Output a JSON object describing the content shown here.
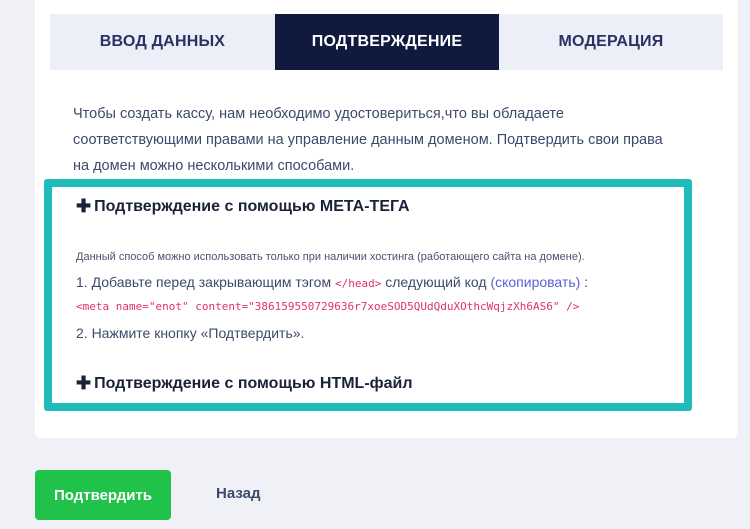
{
  "tabs": [
    {
      "label": "ВВОД ДАННЫХ",
      "active": false
    },
    {
      "label": "ПОДТВЕРЖДЕНИЕ",
      "active": true
    },
    {
      "label": "МОДЕРАЦИЯ",
      "active": false
    }
  ],
  "intro": {
    "line1": "Чтобы создать кассу, нам необходимо удостовериться,что вы обладаете",
    "line2": "соответствующими правами на управление данным доменом. Подтвердить свои права",
    "line3": "на домен можно несколькими способами."
  },
  "methods": [
    {
      "icon": "plus-icon",
      "title": "Подтверждение с помощью МЕТА-ТЕГА"
    },
    {
      "icon": "plus-icon",
      "title": "Подтверждение с помощью HTML-файл"
    }
  ],
  "meta_method": {
    "note": "Данный способ можно использовать только при наличии хостинга (работающего сайта на домене).",
    "step1_prefix": "1. Добавьте перед закрывающим тэгом ",
    "step1_tag": "</head>",
    "step1_middle": " следующий код ",
    "step1_copy": "(скопировать)",
    "step1_suffix": " :",
    "code": "<meta name=\"enot\" content=\"386159550729636r7xoeSOD5QUdQduXOthcWqjzXh6AS6\" />",
    "step2": "2. Нажмите кнопку «Подтвердить»."
  },
  "actions": {
    "confirm_label": "Подтвердить",
    "back_label": "Назад"
  },
  "colors": {
    "accent_teal": "#1fbcbc",
    "tab_active_bg": "#101a3f",
    "confirm_green": "#21c24a",
    "code_pink": "#e0316b",
    "link_purple": "#5b5fd6"
  }
}
